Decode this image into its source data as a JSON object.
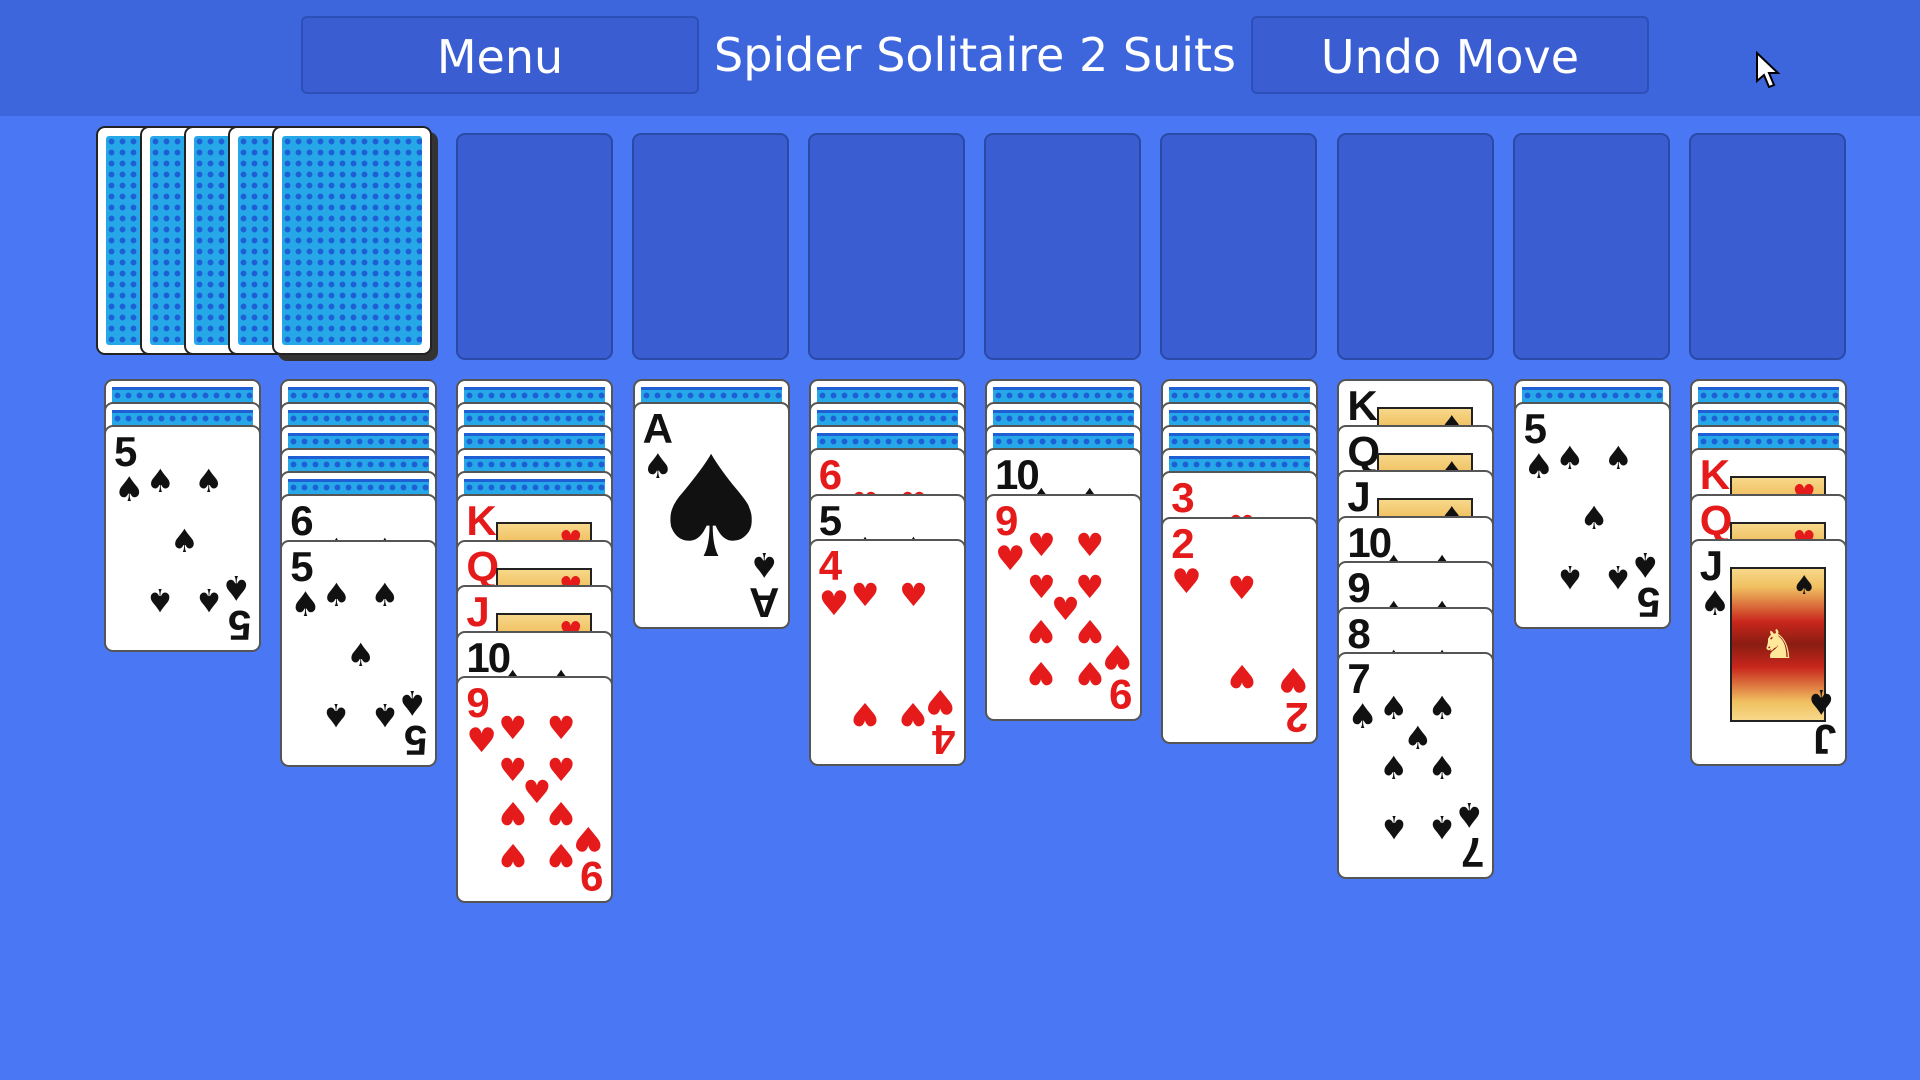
{
  "header": {
    "menu_label": "Menu",
    "title": "Spider Solitaire 2 Suits",
    "undo_label": "Undo Move"
  },
  "stock": {
    "remaining_deals": 5
  },
  "foundation_slots": 8,
  "tableau": [
    {
      "down": 2,
      "up": [
        {
          "rank": "5",
          "suit": "spades"
        }
      ]
    },
    {
      "down": 5,
      "up": [
        {
          "rank": "6",
          "suit": "spades"
        },
        {
          "rank": "5",
          "suit": "spades"
        }
      ]
    },
    {
      "down": 5,
      "up": [
        {
          "rank": "K",
          "suit": "hearts"
        },
        {
          "rank": "Q",
          "suit": "hearts"
        },
        {
          "rank": "J",
          "suit": "hearts"
        },
        {
          "rank": "10",
          "suit": "spades"
        },
        {
          "rank": "9",
          "suit": "hearts"
        }
      ]
    },
    {
      "down": 1,
      "up": [
        {
          "rank": "A",
          "suit": "spades"
        }
      ]
    },
    {
      "down": 3,
      "up": [
        {
          "rank": "6",
          "suit": "hearts"
        },
        {
          "rank": "5",
          "suit": "spades"
        },
        {
          "rank": "4",
          "suit": "hearts"
        }
      ]
    },
    {
      "down": 3,
      "up": [
        {
          "rank": "10",
          "suit": "spades"
        },
        {
          "rank": "9",
          "suit": "hearts"
        }
      ]
    },
    {
      "down": 4,
      "up": [
        {
          "rank": "3",
          "suit": "hearts"
        },
        {
          "rank": "2",
          "suit": "hearts"
        }
      ]
    },
    {
      "down": 0,
      "up": [
        {
          "rank": "K",
          "suit": "spades"
        },
        {
          "rank": "Q",
          "suit": "spades"
        },
        {
          "rank": "J",
          "suit": "spades"
        },
        {
          "rank": "10",
          "suit": "spades"
        },
        {
          "rank": "9",
          "suit": "spades"
        },
        {
          "rank": "8",
          "suit": "spades"
        },
        {
          "rank": "7",
          "suit": "spades"
        }
      ]
    },
    {
      "down": 1,
      "up": [
        {
          "rank": "5",
          "suit": "spades"
        }
      ]
    },
    {
      "down": 3,
      "up": [
        {
          "rank": "K",
          "suit": "hearts"
        },
        {
          "rank": "Q",
          "suit": "hearts"
        },
        {
          "rank": "J",
          "suit": "spades"
        }
      ]
    }
  ],
  "colors": {
    "background": "#4a78f5",
    "topbar": "#3d66dd",
    "card_back": "#26a7e8",
    "red_suit": "#e51b1b",
    "black_suit": "#111111"
  }
}
